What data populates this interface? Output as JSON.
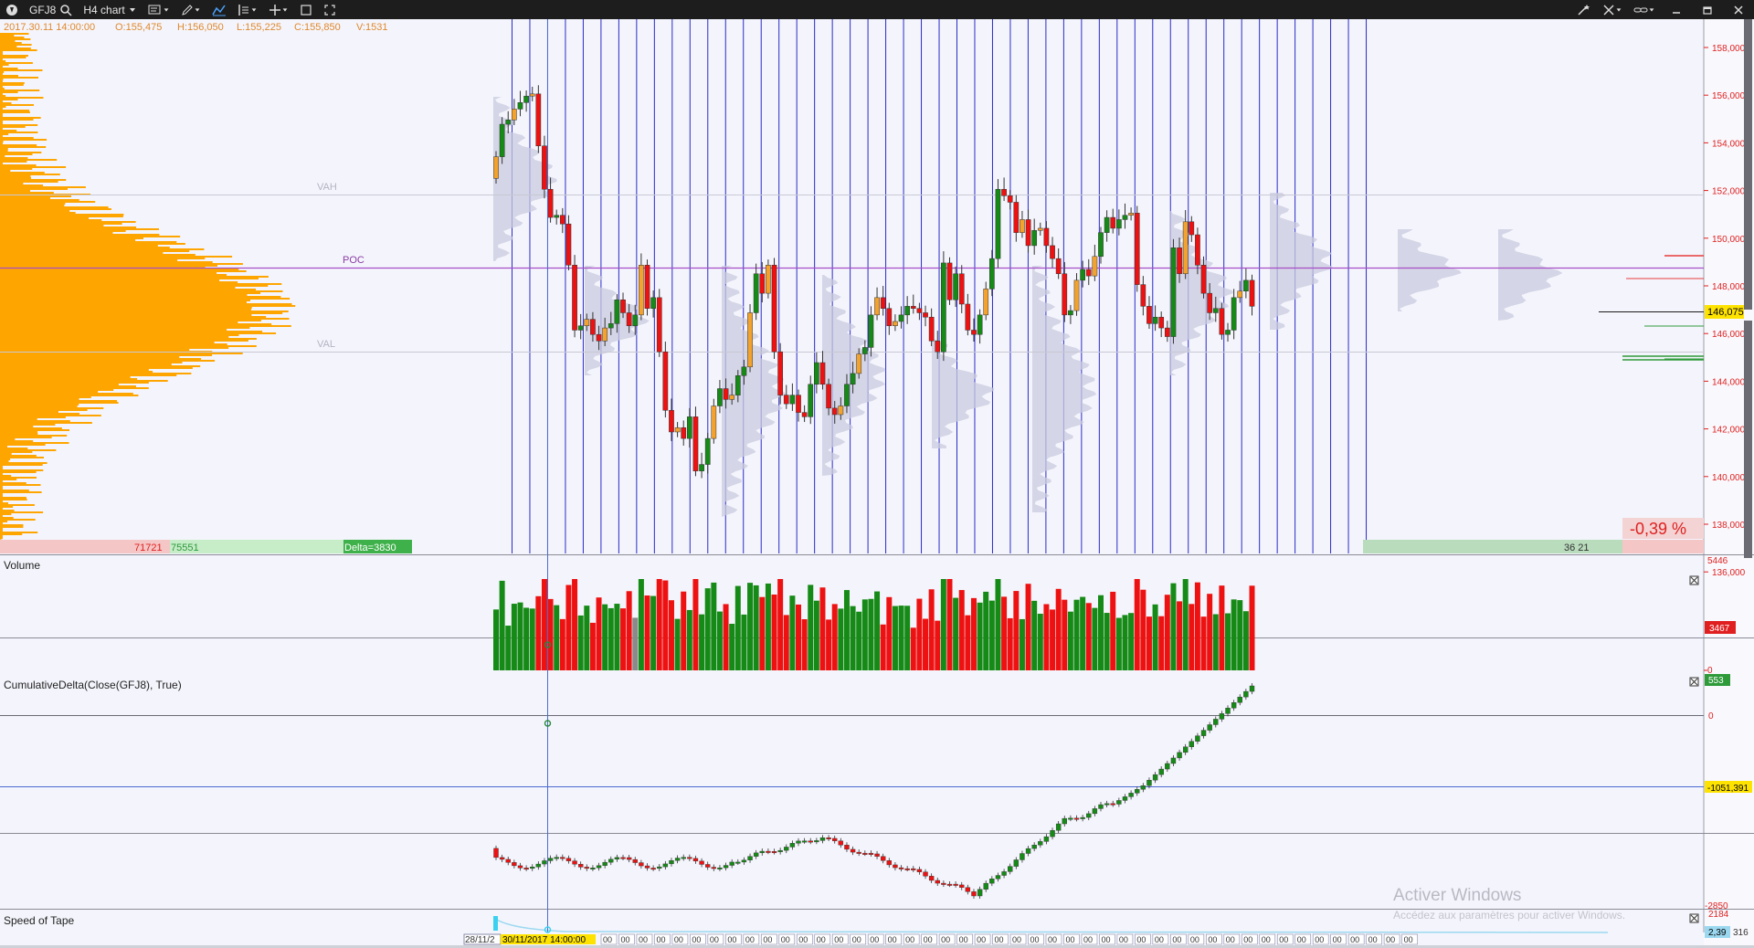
{
  "toolbar": {
    "symbol": "GFJ8",
    "timeframe": "H4 chart",
    "icons": [
      "app-logo-icon",
      "search-icon",
      "chevron-down-icon",
      "chart-type-icon",
      "pencil-icon",
      "line-chart-icon",
      "indicators-icon",
      "crosshair-icon",
      "window-icon",
      "maximize-icon",
      "magic-wand-icon",
      "sync-icon",
      "link-icon",
      "minimize-icon",
      "restore-icon",
      "close-icon"
    ]
  },
  "price_chart": {
    "ohlc_line": {
      "datetime": "2017.30.11 14:00:00",
      "open": "O:155,475",
      "high": "H:156,050",
      "low": "L:155,225",
      "close": "C:155,850",
      "volume": "V:1531"
    },
    "vah_label": "VAH",
    "poc_label": "POC",
    "val_label": "VAL",
    "profile_footer": {
      "sell": "71721",
      "buy": "75551",
      "delta": "Delta=3830"
    },
    "right_footer": "36 21",
    "change_pct": "-0,39 %",
    "current_price": "146,075",
    "price_axis": [
      "158,000",
      "156,000",
      "154,000",
      "152,000",
      "150,000",
      "148,000",
      "146,000",
      "144,000",
      "142,000",
      "140,000",
      "138,000",
      "136,000"
    ],
    "colors": {
      "profile": "#ffa500",
      "up": "#168a16",
      "down": "#ee1111",
      "tpo_up": "#f2a22d",
      "vline": "#2a2ac8",
      "poc": "#a64ec6"
    }
  },
  "volume_panel": {
    "title": "Volume",
    "axis": [
      "5446",
      "0"
    ],
    "last_value": "3467"
  },
  "delta_panel": {
    "title": "CumulativeDelta(Close(GFJ8), True)",
    "axis": [
      "0",
      "-2850"
    ],
    "last_value": "553",
    "crosshair_value": "-1051,391"
  },
  "tape_panel": {
    "title": "Speed of Tape",
    "axis_top": "2184",
    "last_value": "2,39",
    "axis_clip": "316"
  },
  "time_axis": {
    "left_label": "28/11/2",
    "crosshair_label": "30/11/2017 14:00:00",
    "tick_fragment": "00"
  },
  "watermark": {
    "line1": "Activer Windows",
    "line2": "Accédez aux paramètres pour activer Windows."
  },
  "chart_data": {
    "type": "candlestick",
    "symbol": "GFJ8",
    "timeframe": "H4",
    "ylim": [
      136000,
      158000
    ],
    "close_prices": [
      153000,
      154500,
      154700,
      155200,
      155500,
      155800,
      155900,
      153500,
      151500,
      150200,
      150300,
      149900,
      148000,
      145000,
      145200,
      145500,
      144800,
      144500,
      145100,
      145300,
      146400,
      145800,
      145200,
      145700,
      148000,
      146000,
      146500,
      144000,
      141300,
      140300,
      140500,
      140000,
      141000,
      138500,
      138800,
      140000,
      141500,
      142300,
      141800,
      142000,
      142900,
      143300,
      145800,
      147600,
      146700,
      148000,
      144000,
      142000,
      141600,
      142000,
      141200,
      141000,
      142500,
      143500,
      142500,
      141400,
      141100,
      141500,
      142500,
      143000,
      143900,
      144200,
      145700,
      146500,
      146000,
      145200,
      145400,
      145700,
      146100,
      146000,
      145800,
      145600,
      144500,
      144000,
      148100,
      146400,
      147600,
      146200,
      145000,
      144800,
      145700,
      146900,
      148300,
      151500,
      151200,
      150900,
      149500,
      150100,
      148900,
      149600,
      149700,
      148900,
      148300,
      147600,
      145700,
      145900,
      147300,
      147800,
      147500,
      148400,
      149500,
      150200,
      149700,
      150100,
      150300,
      150400,
      147100,
      146100,
      145300,
      145600,
      145100,
      144700,
      148800,
      147600,
      150000,
      149400,
      148000,
      146700,
      145800,
      146000,
      144800,
      145000,
      146500,
      146800,
      147300,
      146100
    ]
  }
}
